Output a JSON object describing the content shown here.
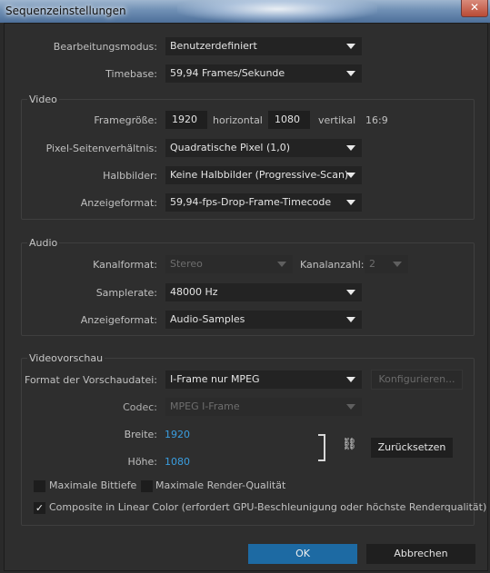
{
  "window": {
    "title": "Sequenzeinstellungen",
    "close_icon": "close-icon"
  },
  "general": {
    "edit_mode_label": "Bearbeitungsmodus:",
    "edit_mode_value": "Benutzerdefiniert",
    "timebase_label": "Timebase:",
    "timebase_value": "59,94 Frames/Sekunde"
  },
  "video": {
    "title": "Video",
    "frame_size_label": "Framegröße:",
    "width_value": "1920",
    "horizontal_label": "horizontal",
    "height_value": "1080",
    "vertical_label": "vertikal",
    "aspect": "16:9",
    "pixel_aspect_label": "Pixel-Seitenverhältnis:",
    "pixel_aspect_value": "Quadratische Pixel (1,0)",
    "fields_label": "Halbbilder:",
    "fields_value": "Keine Halbbilder (Progressive-Scan)",
    "display_format_label": "Anzeigeformat:",
    "display_format_value": "59,94-fps-Drop-Frame-Timecode"
  },
  "audio": {
    "title": "Audio",
    "channel_format_label": "Kanalformat:",
    "channel_format_value": "Stereo",
    "channel_count_label": "Kanalanzahl:",
    "channel_count_value": "2",
    "sample_rate_label": "Samplerate:",
    "sample_rate_value": "48000 Hz",
    "display_format_label": "Anzeigeformat:",
    "display_format_value": "Audio-Samples"
  },
  "preview": {
    "title": "Videovorschau",
    "file_format_label": "Format der Vorschaudatei:",
    "file_format_value": "I-Frame nur MPEG",
    "configure_label": "Konfigurieren...",
    "codec_label": "Codec:",
    "codec_value": "MPEG I-Frame",
    "width_label": "Breite:",
    "width_value": "1920",
    "height_label": "Höhe:",
    "height_value": "1080",
    "link_icon": "chain-link-icon",
    "reset_label": "Zurücksetzen",
    "max_bit_depth_label": "Maximale Bittiefe",
    "max_bit_depth_checked": false,
    "max_render_quality_label": "Maximale Render-Qualität",
    "max_render_quality_checked": false,
    "composite_label": "Composite in Linear Color (erfordert GPU-Beschleunigung oder höchste Renderqualität)",
    "composite_checked": true
  },
  "footer": {
    "ok_label": "OK",
    "cancel_label": "Abbrechen"
  },
  "colors": {
    "accent": "#1d6aa3",
    "link": "#3a9ee0",
    "background": "#2e2e2e"
  }
}
